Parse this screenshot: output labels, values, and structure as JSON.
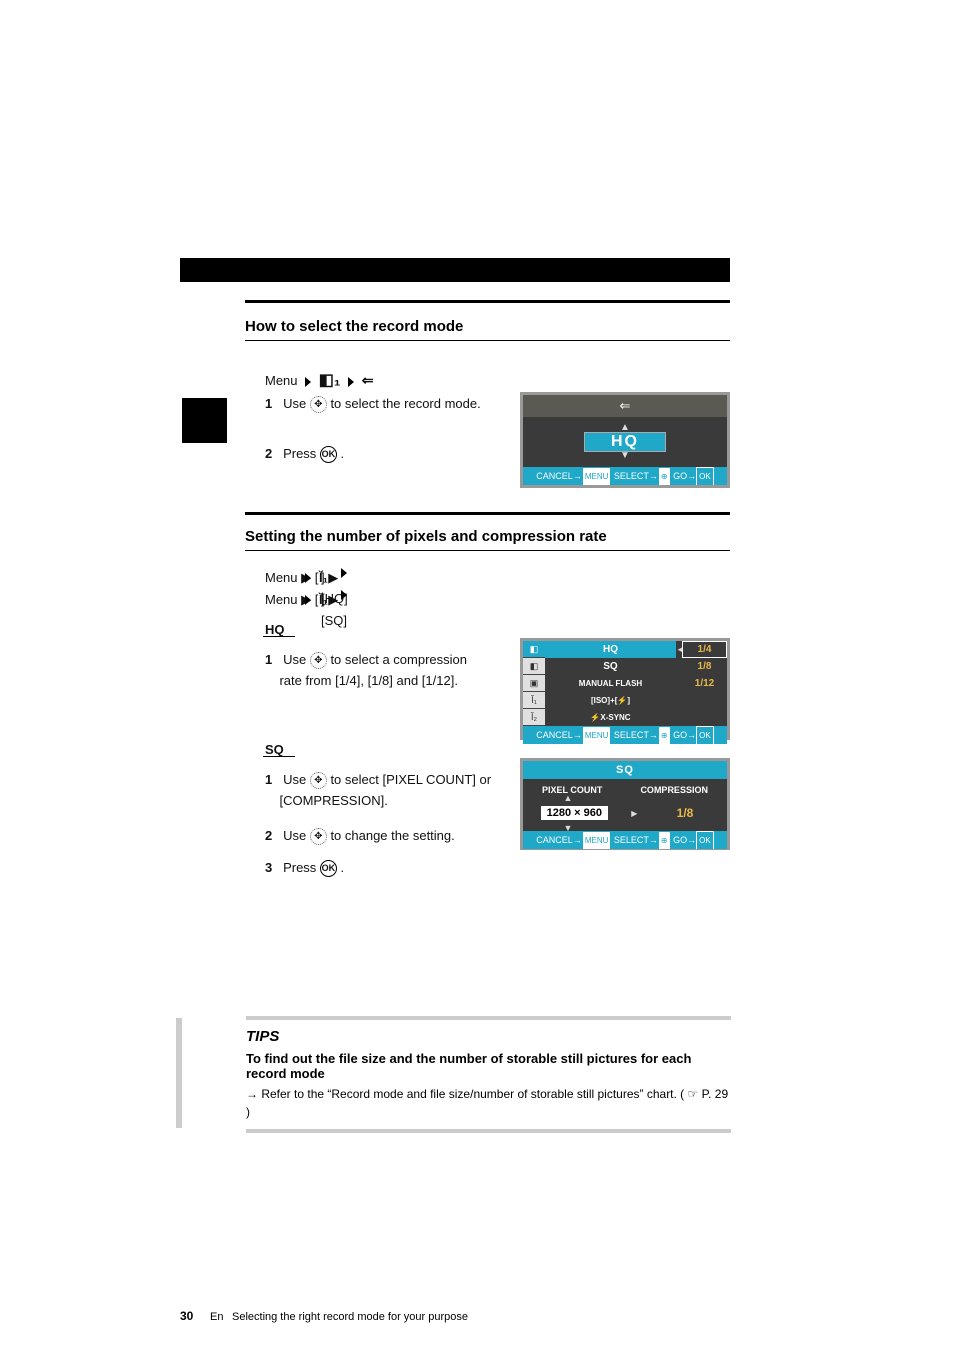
{
  "page": {
    "number": "30",
    "lang": "En",
    "running_title": "Selecting the right record mode for your purpose"
  },
  "sec1": {
    "title": "How to select the record mode",
    "menu_path": "Menu  ▶  [Camera1]  ▶  [Record Mode]",
    "step1_num": "1",
    "step1_a": "Use ",
    "step1_b": " to select the record mode.",
    "step2_num": "2",
    "step2_a": "Press ",
    "step2_b": "."
  },
  "lcd1": {
    "selected": "HQ",
    "foot_cancel": "CANCEL",
    "foot_menu": "MENU",
    "foot_select": "SELECT",
    "foot_go": "GO",
    "foot_ok": "OK"
  },
  "sec2": {
    "title": "Setting the number of pixels and compression rate",
    "menu_hq_a": "Menu  ▶  [",
    "menu_hq_b": "]  ▶  [HQ]",
    "menu_sq_a": "Menu  ▶  [",
    "menu_sq_b": "]  ▶  [SQ]",
    "hq": {
      "head_num": "HQ",
      "step1_num": "1",
      "step1_a": "Use ",
      "step1_b": " to select a compression",
      "step1_c": "rate from [1/4], [1/8] and [1/12]."
    },
    "sq": {
      "head_num": "SQ",
      "step1_num": "1",
      "step1_a": "Use ",
      "step1_b": " to select [PIXEL COUNT] or",
      "step1_c": "[COMPRESSION].",
      "step2_num": "2",
      "step2_a": "Use ",
      "step2_b": " to change the setting.",
      "step3_num": "3",
      "step3_a": "Press ",
      "step3_b": "."
    }
  },
  "lcd2": {
    "rows": [
      {
        "tab": "",
        "lbl": "HQ",
        "val": "1/4",
        "sel_lbl": true,
        "sel_val": true
      },
      {
        "tab": "",
        "lbl": "SQ",
        "val": "1/8"
      },
      {
        "tab": "",
        "lbl": "MANUAL FLASH",
        "val": "1/12",
        "small": true
      },
      {
        "tab": "1",
        "lbl": "[ISO+F]",
        "val": ""
      },
      {
        "tab": "2",
        "lbl": "X-SYNC",
        "val": "",
        "flash": true
      }
    ],
    "foot_cancel": "CANCEL",
    "foot_menu": "MENU",
    "foot_select": "SELECT",
    "foot_go": "GO",
    "foot_ok": "OK"
  },
  "lcd3": {
    "title": "SQ",
    "col1": "PIXEL COUNT",
    "col2": "COMPRESSION",
    "pixel": "1280 × 960",
    "comp": "1/8",
    "foot_cancel": "CANCEL",
    "foot_menu": "MENU",
    "foot_select": "SELECT",
    "foot_go": "GO",
    "foot_ok": "OK"
  },
  "tips": {
    "title": "TIPS",
    "sub": "To find out the file size and the number of storable still pictures for each record mode",
    "body_a": "→ Refer to the “Record mode and file size/number of storable still pictures” chart. (",
    "body_ref": "P. 29",
    "body_b": ")"
  }
}
